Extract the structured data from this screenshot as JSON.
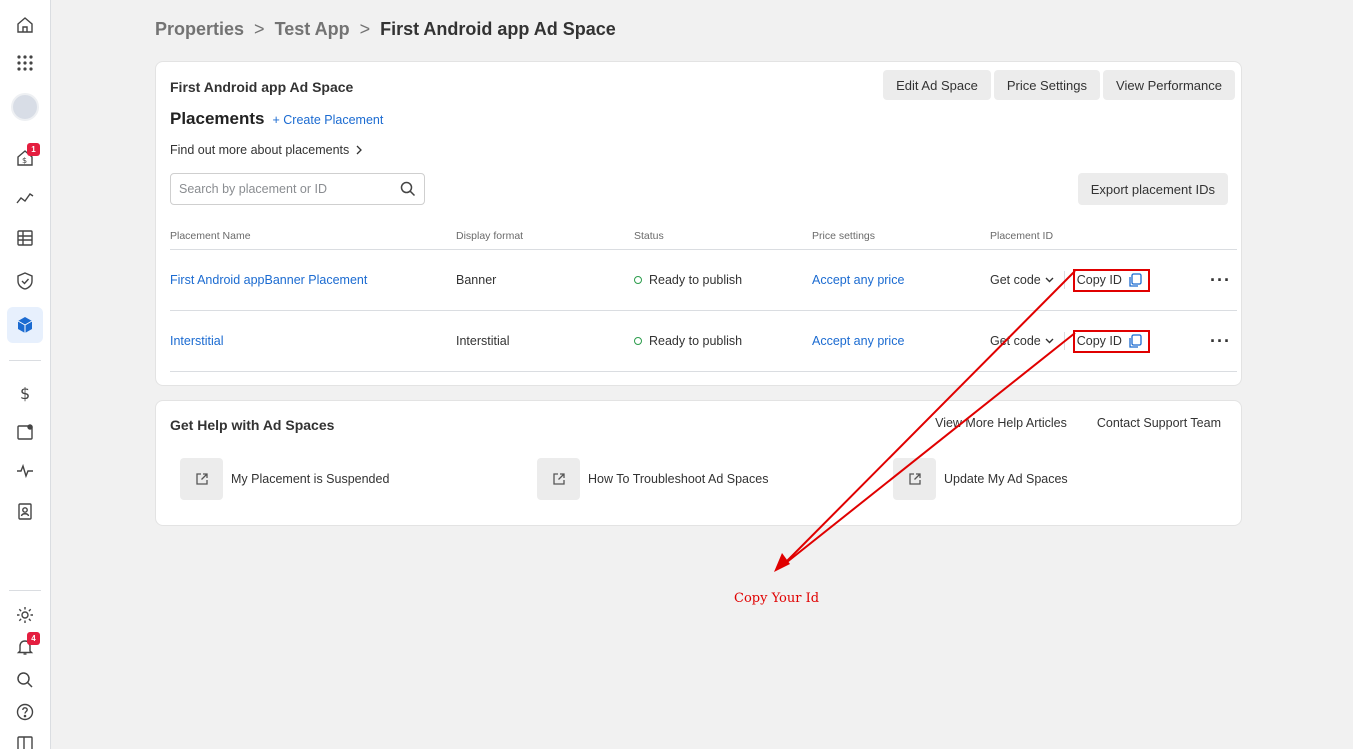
{
  "breadcrumb": {
    "items": [
      "Properties",
      "Test App"
    ],
    "current": "First Android app Ad Space",
    "separator": ">"
  },
  "rail": {
    "badges": {
      "monetization": "1",
      "notifications": "4"
    },
    "accent_color": "#1b6bd1"
  },
  "ad_space": {
    "title": "First Android app Ad Space",
    "actions": [
      "Edit Ad Space",
      "Price Settings",
      "View Performance"
    ]
  },
  "placements": {
    "title": "Placements",
    "create_link": "+ Create Placement",
    "learn_more": "Find out more about placements",
    "search_placeholder": "Search by placement or ID",
    "export_button": "Export placement IDs",
    "columns": [
      "Placement Name",
      "Display format",
      "Status",
      "Price settings",
      "Placement ID"
    ],
    "rows": [
      {
        "name": "First Android appBanner Placement",
        "format": "Banner",
        "status": "Ready to publish",
        "price": "Accept any price",
        "get_code": "Get code",
        "copy_id": "Copy ID",
        "more": "···"
      },
      {
        "name": "Interstitial",
        "format": "Interstitial",
        "status": "Ready to publish",
        "price": "Accept any price",
        "get_code": "Get code",
        "copy_id": "Copy ID",
        "more": "···"
      }
    ],
    "status_color": "#2c9d4c"
  },
  "help": {
    "title": "Get Help with Ad Spaces",
    "links": [
      "View More Help Articles",
      "Contact Support Team"
    ],
    "items": [
      "My Placement is Suspended",
      "How To Troubleshoot Ad Spaces",
      "Update My Ad Spaces"
    ]
  },
  "annotation": {
    "label": "Copy Your Id",
    "color": "#e00000"
  }
}
